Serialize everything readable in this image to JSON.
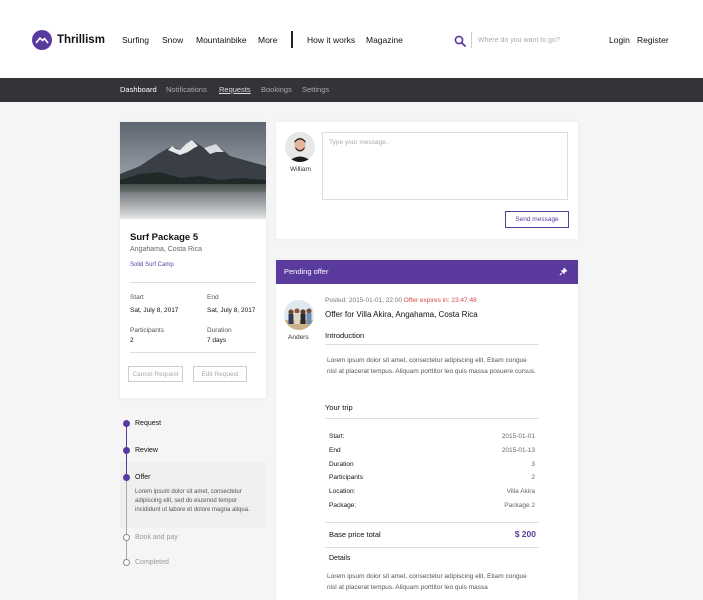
{
  "header": {
    "brand": "Thrillism",
    "nav": [
      "Surfing",
      "Snow",
      "Mountainbike",
      "More",
      "How it works",
      "Magazine"
    ],
    "search_placeholder": "Where do you want to go?",
    "login": "Login",
    "register": "Register"
  },
  "subnav": {
    "items": [
      "Dashboard",
      "Notifications",
      "Requests",
      "Bookings",
      "Settings"
    ],
    "active": "Requests"
  },
  "package": {
    "title": "Surf Package 5",
    "location": "Angahama, Costa Rica",
    "camp": "Solid Surf Camp",
    "start_label": "Start",
    "start_value": "Sat, July 8, 2017",
    "end_label": "End",
    "end_value": "Sat, July 8, 2017",
    "participants_label": "Participants",
    "participants_value": "2",
    "duration_label": "Duration",
    "duration_value": "7 days",
    "cancel_label": "Cancel Request",
    "edit_label": "Edit Request"
  },
  "timeline": {
    "steps": [
      "Request",
      "Review",
      "Offer",
      "Book and pay",
      "Completed"
    ],
    "current_step": "Offer",
    "offer_description": "Lorem ipsum dolor sit amet, consectetur adipiscing elit, sed do eiusmod tempor incididunt ut labore et dolore magna aliqua."
  },
  "message": {
    "user_name": "William",
    "placeholder": "Type your message..",
    "send_label": "Send message"
  },
  "offer": {
    "header_title": "Pending offer",
    "sender_name": "Anders",
    "posted": "Posted: 2015-01-01, 22:00",
    "expires_label": "Offer expires in:",
    "expires_value": "23:47:48",
    "title": "Offer for Villa Akira, Angahama, Costa Rica",
    "intro_title": "Introduction",
    "intro_text": "Lorem ipsum dolor sit amet, consectetur adipiscing elit. Etiam congue nisl at placerat tempus. Aliquam porttitor leo quis massa posuere cursus.",
    "trip_title": "Your trip",
    "trip_rows": [
      {
        "label": "Start:",
        "value": "2015-01-01"
      },
      {
        "label": "End",
        "value": "2015-01-13"
      },
      {
        "label": "Duration",
        "value": "3"
      },
      {
        "label": "Participants",
        "value": "2"
      },
      {
        "label": "Location:",
        "value": "Villa Akira"
      },
      {
        "label": "Package:",
        "value": "Package 2"
      }
    ],
    "total_label": "Base price total",
    "total_value": "$ 200",
    "details_title": "Details",
    "details_text": "Lorem ipsum dolor sit amet, consectetur adipiscing elit. Etiam congue nisl at placerat tempus. Aliquam porttitor leo quis massa"
  },
  "colors": {
    "brand": "#5b3a9e",
    "subnav_bg": "#333338",
    "expires": "#d34848"
  }
}
